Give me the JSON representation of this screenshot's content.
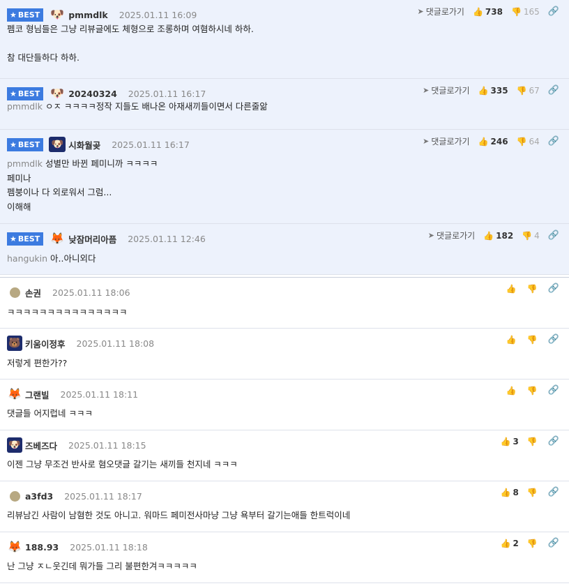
{
  "labels": {
    "best": "BEST",
    "reply": "댓글로가기"
  },
  "best_comments": [
    {
      "avatar_icon": "dog-icon",
      "nick": "pmmdlk",
      "date": "2025.01.11 16:09",
      "up": "738",
      "down": "165",
      "mention": "",
      "lines": [
        "펨코 형님들은 그냥 리뷰글에도 체형으로 조롱하며 여혐하시네 하하.",
        "",
        "참 대단들하다 하하."
      ]
    },
    {
      "avatar_icon": "dog-icon",
      "nick": "20240324",
      "date": "2025.01.11 16:17",
      "up": "335",
      "down": "67",
      "mention": "pmmdlk",
      "lines": [
        "ㅇㅈ ㅋㅋㅋㅋ정작 지들도 배나온 아재새끼들이면서 다른줄앎"
      ]
    },
    {
      "avatar_icon": "dog-face-icon",
      "nick": "시화월곶",
      "date": "2025.01.11 16:17",
      "up": "246",
      "down": "64",
      "mention": "pmmdlk",
      "lines": [
        "성별만 바뀐 페미니까 ㅋㅋㅋㅋ",
        "페미나",
        "펨붕이나 다 외로워서 그럼...",
        "이해해"
      ]
    },
    {
      "avatar_icon": "fox-icon",
      "nick": "낮잠머리아픔",
      "date": "2025.01.11 12:46",
      "up": "182",
      "down": "4",
      "mention": "hangukin",
      "lines": [
        "아..아니외다"
      ]
    }
  ],
  "comments": [
    {
      "avatar_icon": "dot-avatar",
      "nick": "손권",
      "date": "2025.01.11 18:06",
      "up": "",
      "lines": [
        "ㅋㅋㅋㅋㅋㅋㅋㅋㅋㅋㅋㅋㅋㅋㅋ"
      ]
    },
    {
      "avatar_icon": "bear-icon",
      "nick": "키움이정후",
      "date": "2025.01.11 18:08",
      "up": "",
      "lines": [
        "저렇게 편한가??"
      ]
    },
    {
      "avatar_icon": "fox-icon",
      "nick": "그랜빌",
      "date": "2025.01.11 18:11",
      "up": "",
      "lines": [
        "댓글들 어지럽네 ㅋㅋㅋ"
      ]
    },
    {
      "avatar_icon": "dog-face-icon",
      "nick": "즈베즈다",
      "date": "2025.01.11 18:15",
      "up": "3",
      "lines": [
        "이젠 그냥 무조건 반사로 혐오댓글 갈기는 새끼들 천지네 ㅋㅋㅋ"
      ]
    },
    {
      "avatar_icon": "dot-avatar",
      "nick": "a3fd3",
      "date": "2025.01.11 18:17",
      "up": "8",
      "lines": [
        "리뷰남긴 사람이 남혐한 것도 아니고. 워마드 페미전사마냥 그냥 욕부터 갈기는애들 한트럭이네"
      ]
    },
    {
      "avatar_icon": "fox-icon",
      "nick": "188.93",
      "date": "2025.01.11 18:18",
      "up": "2",
      "lines": [
        "난 그냥 ㅈㄴ웃긴데 뭐가들 그리 불편한겨ㅋㅋㅋㅋㅋ"
      ]
    }
  ]
}
